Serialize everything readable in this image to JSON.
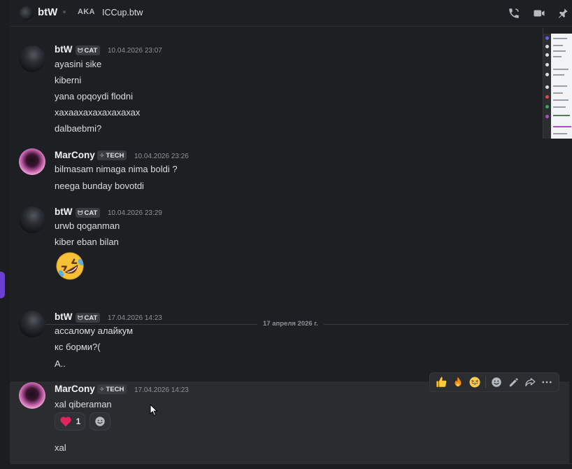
{
  "header": {
    "title": "btW",
    "aka_label": "AKA",
    "aka_name": "ICCup.btw",
    "icons": [
      "call-icon",
      "video-icon",
      "pin-icon"
    ]
  },
  "messages": [
    {
      "author": "btW",
      "tag": "CAT",
      "timestamp": "10.04.2026 23:07",
      "avatar": "dark",
      "lines": [
        "ayasini sike",
        "kiberni",
        "yana opqoydi flodni",
        "хахаахахахахахахах",
        "dalbaebmi?"
      ]
    },
    {
      "author": "MarCony",
      "tag": "TECH",
      "timestamp": "10.04.2026 23:26",
      "avatar": "pink",
      "lines": [
        "bilmasam nimaga nima boldi ?",
        "neega bunday bovotdi"
      ]
    },
    {
      "author": "btW",
      "tag": "CAT",
      "timestamp": "10.04.2026 23:29",
      "avatar": "dark",
      "lines": [
        "urwb qoganman",
        "kiber eban bilan"
      ],
      "emoji": "rolling-on-floor-laughing"
    },
    {
      "author": "btW",
      "tag": "CAT",
      "timestamp": "17.04.2026 14:23",
      "avatar": "dark",
      "lines": [
        "ассалому алайкум",
        "кс борми?(",
        "А.."
      ]
    },
    {
      "author": "MarCony",
      "tag": "TECH",
      "timestamp": "17.04.2026 14:23",
      "avatar": "pink",
      "lines": [
        "xal qiberaman",
        "xal"
      ],
      "reactions": [
        {
          "emoji": "red-heart",
          "count": "1"
        }
      ]
    }
  ],
  "date_divider": "17 апреля 2026 г.",
  "toolbar": {
    "quick_reactions": [
      "thumbs-up",
      "fire",
      "grinning-squinting-face"
    ],
    "actions": [
      "add-reaction-icon",
      "edit-icon",
      "forward-icon",
      "more-icon"
    ]
  },
  "colors": {
    "background": "#1e1f23",
    "hover_row": "#2a2c30",
    "tag_bg": "#3a3b41",
    "text": "#dbdee1",
    "timestamp": "#8e9297",
    "accent_purple": "#6d3fd0"
  }
}
